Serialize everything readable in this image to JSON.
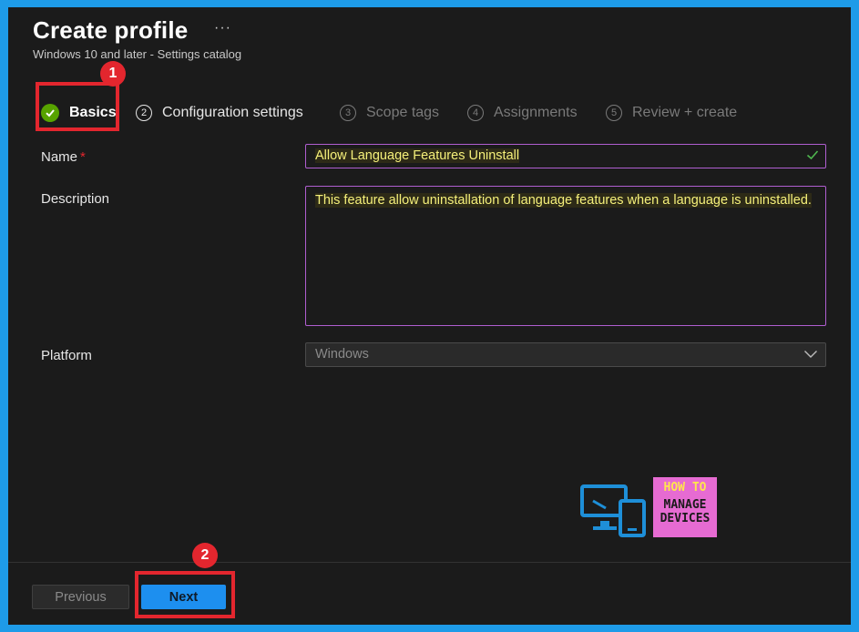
{
  "header": {
    "title": "Create profile",
    "more_label": "···",
    "subtitle": "Windows 10 and later - Settings catalog"
  },
  "steps": [
    {
      "label": "Basics",
      "state": "complete"
    },
    {
      "number": "2",
      "label": "Configuration settings",
      "state": "next"
    },
    {
      "number": "3",
      "label": "Scope tags",
      "state": "disabled"
    },
    {
      "number": "4",
      "label": "Assignments",
      "state": "disabled"
    },
    {
      "number": "5",
      "label": "Review + create",
      "state": "disabled"
    }
  ],
  "annotations": {
    "badge1": "1",
    "badge2": "2"
  },
  "form": {
    "name_label": "Name",
    "required_mark": "*",
    "name_value": "Allow Language Features Uninstall",
    "description_label": "Description",
    "description_value": "This feature allow uninstallation of language features when a language is uninstalled.",
    "platform_label": "Platform",
    "platform_value": "Windows"
  },
  "footer": {
    "previous_label": "Previous",
    "next_label": "Next"
  },
  "logo": {
    "line1": "HOW TO",
    "line2": "MANAGE",
    "line3": "DEVICES"
  },
  "colors": {
    "accent": "#1d8fef",
    "highlight_border": "#e3262e",
    "success": "#57a300",
    "logo_bg": "#e66bd2"
  }
}
